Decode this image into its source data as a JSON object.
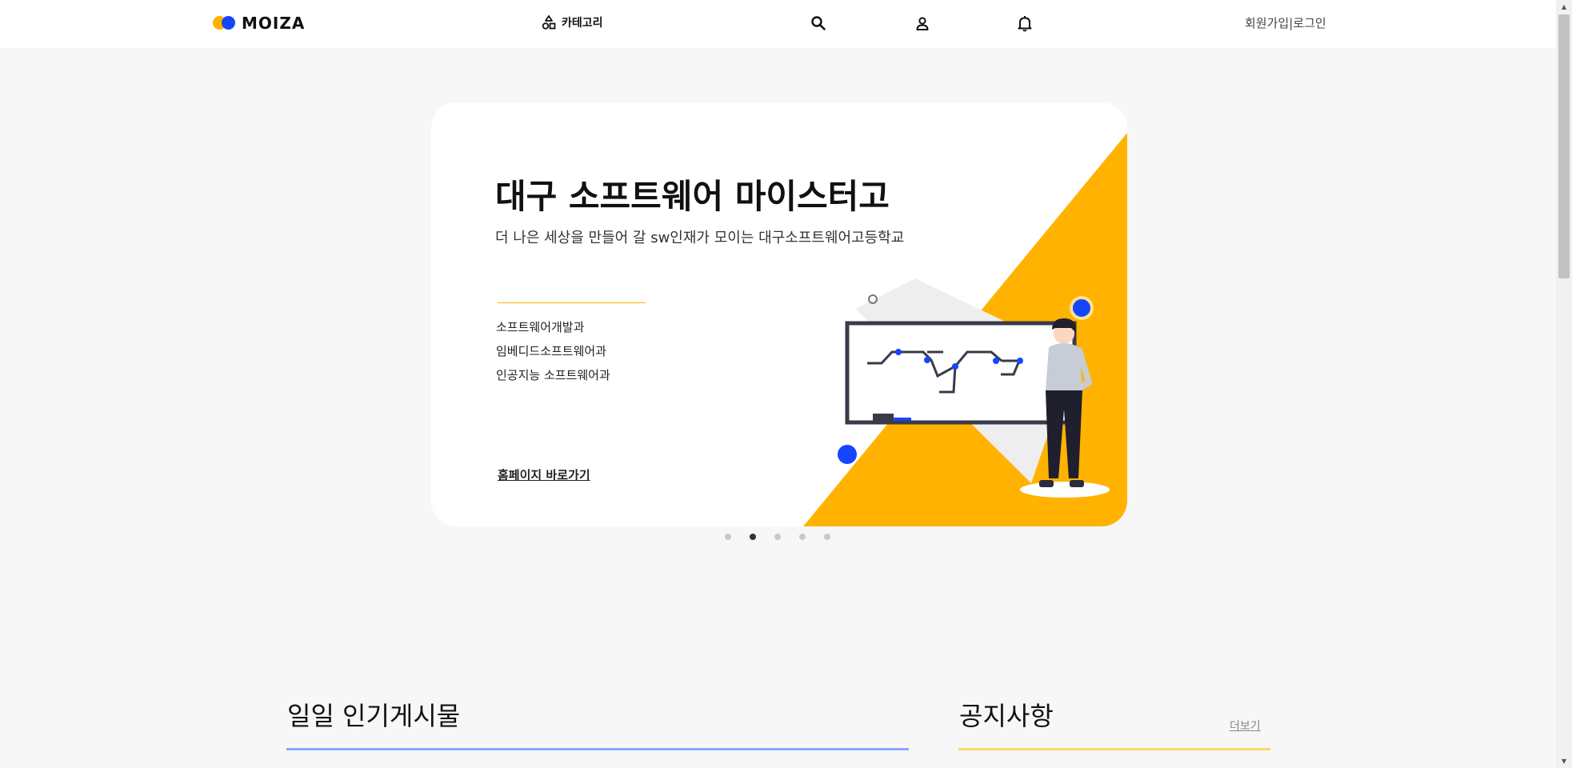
{
  "header": {
    "logo_text": "MOIZA",
    "category_label": "카테고리",
    "signup_label": "회원가입",
    "separator": "|",
    "login_label": "로그인"
  },
  "hero": {
    "title": "대구 소프트웨어 마이스터고",
    "subtitle": "더 나은 세상을 만들어 갈 sw인재가 모이는 대구소프트웨어고등학교",
    "departments": [
      "소프트웨어개발과",
      "임베디드소프트웨어과",
      "인공지능 소프트웨어과"
    ],
    "link_label": "홈페이지 바로가기"
  },
  "carousel": {
    "slide_count": 5,
    "active_index": 1
  },
  "sections": {
    "popular_title": "일일 인기게시물",
    "notice_title": "공지사항",
    "notice_more": "더보기"
  },
  "colors": {
    "brand_yellow": "#ffb300",
    "brand_blue": "#1446ff",
    "popular_underline": "#8aa6ff",
    "notice_underline": "#ffd66b"
  }
}
